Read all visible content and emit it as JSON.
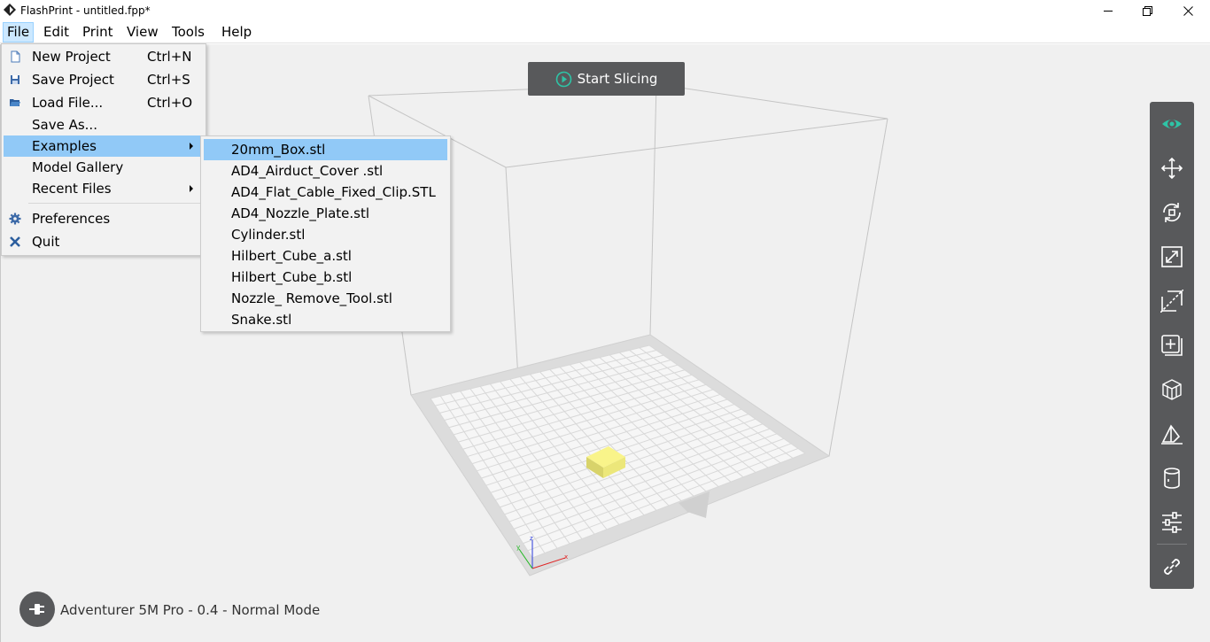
{
  "window": {
    "title": "FlashPrint - untitled.fpp*"
  },
  "menubar": {
    "items": [
      {
        "label": "File"
      },
      {
        "label": "Edit"
      },
      {
        "label": "Print"
      },
      {
        "label": "View"
      },
      {
        "label": "Tools"
      },
      {
        "label": "Help"
      }
    ]
  },
  "file_menu": {
    "items": [
      {
        "label": "New Project",
        "shortcut": "Ctrl+N",
        "icon": "new-file-icon"
      },
      {
        "label": "Save Project",
        "shortcut": "Ctrl+S",
        "icon": "save-icon"
      },
      {
        "label": "Load File...",
        "shortcut": "Ctrl+O",
        "icon": "folder-open-icon"
      },
      {
        "label": "Save As...",
        "shortcut": ""
      },
      {
        "label": "Examples",
        "shortcut": "",
        "has_submenu": true
      },
      {
        "label": "Model Gallery",
        "shortcut": ""
      },
      {
        "label": "Recent Files",
        "shortcut": "",
        "has_submenu": true
      },
      {
        "label": "Preferences",
        "shortcut": "",
        "icon": "gear-icon"
      },
      {
        "label": "Quit",
        "shortcut": "",
        "icon": "close-x-icon"
      }
    ]
  },
  "examples_submenu": {
    "items": [
      {
        "label": "20mm_Box.stl"
      },
      {
        "label": "AD4_Airduct_Cover .stl"
      },
      {
        "label": "AD4_Flat_Cable_Fixed_Clip.STL"
      },
      {
        "label": "AD4_Nozzle_Plate.stl"
      },
      {
        "label": "Cylinder.stl"
      },
      {
        "label": "Hilbert_Cube_a.stl"
      },
      {
        "label": "Hilbert_Cube_b.stl"
      },
      {
        "label": "Nozzle_ Remove_Tool.stl"
      },
      {
        "label": "Snake.stl"
      }
    ]
  },
  "toolbar": {
    "start_slicing": "Start Slicing",
    "tools": [
      "view-icon",
      "move-icon",
      "rotate-icon",
      "scale-icon",
      "cut-icon",
      "add-copy-icon",
      "supports-icon",
      "place-on-face-icon",
      "cylinder-icon",
      "settings-sliders-icon",
      "link-icon"
    ]
  },
  "status": {
    "printer": "Adventurer 5M Pro - 0.4 - Normal Mode"
  },
  "axes": {
    "x": "x",
    "y": "y",
    "z": "z"
  },
  "colors": {
    "accent": "#2ec4a6",
    "toolbar_bg": "#58595b",
    "menu_highlight": "#91c9f7",
    "model": "#f5f07a"
  }
}
